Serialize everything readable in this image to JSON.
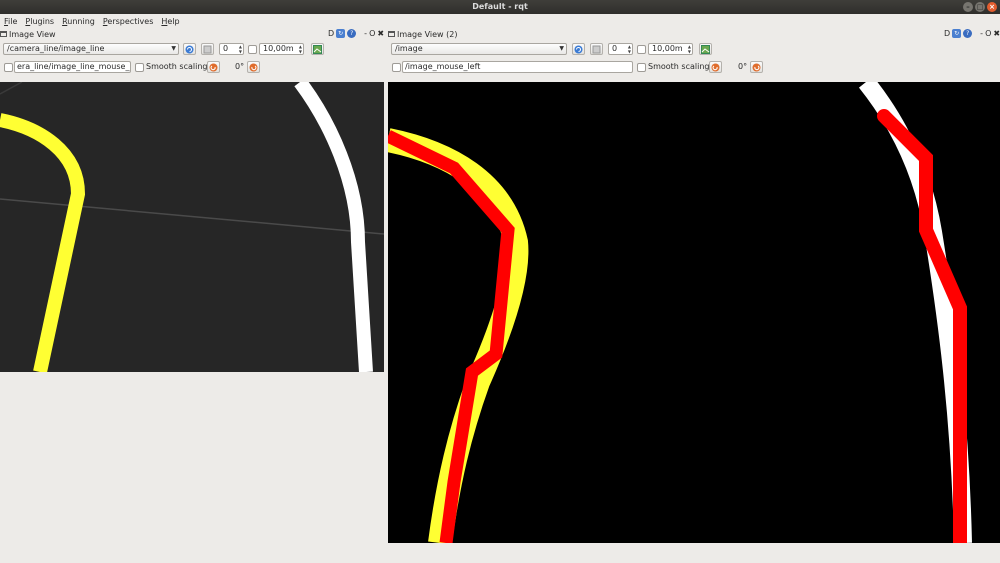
{
  "window": {
    "title": "Default - rqt",
    "btn_minimize": "–",
    "btn_maximize": "□",
    "btn_close": "×"
  },
  "menubar": {
    "items": [
      {
        "first": "F",
        "rest": "ile"
      },
      {
        "first": "P",
        "rest": "lugins"
      },
      {
        "first": "R",
        "rest": "unning"
      },
      {
        "first": "P",
        "rest": "erspectives"
      },
      {
        "first": "H",
        "rest": "elp"
      }
    ]
  },
  "left_panel": {
    "title": "Image View",
    "dock_d": "D",
    "dock_dash": "-",
    "dock_o": "O",
    "dock_x": "✖",
    "topic": "/camera_line/image_line",
    "spin_value": "0",
    "max_value": "10,00m",
    "mouse_topic": "era_line/image_line_mouse_left",
    "smooth_label": "Smooth scaling",
    "rotation": "0°",
    "image_bg": "#262626"
  },
  "right_panel": {
    "title": "Image View (2)",
    "dock_d": "D",
    "dock_dash": "-",
    "dock_o": "O",
    "dock_x": "✖",
    "topic": "/image",
    "spin_value": "0",
    "max_value": "10,00m",
    "mouse_topic": "/image_mouse_left",
    "smooth_label": "Smooth scaling",
    "rotation": "0°",
    "image_bg": "#000000"
  },
  "colors": {
    "yellow_line": "#ffff33",
    "white_line": "#ffffff",
    "red_line": "#ff0000"
  }
}
